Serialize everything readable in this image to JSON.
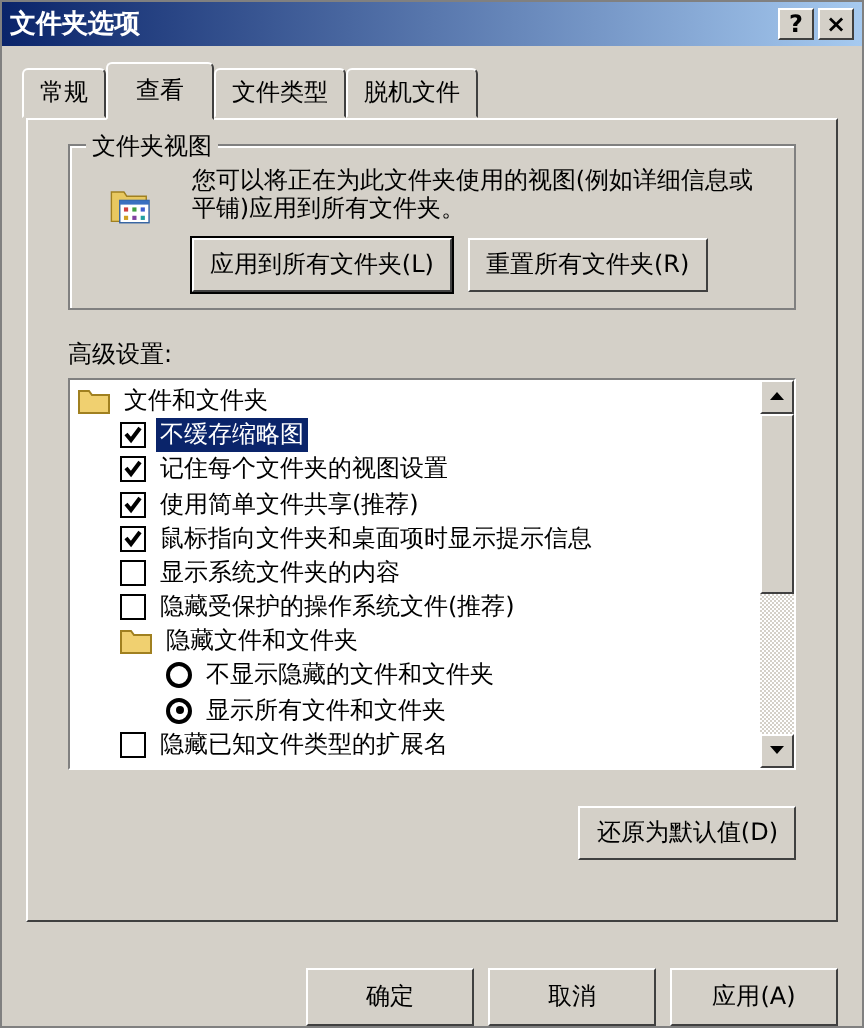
{
  "window": {
    "title": "文件夹选项",
    "help_button": "?",
    "close_button": "×"
  },
  "tabs": [
    {
      "label": "常规",
      "selected": false
    },
    {
      "label": "查看",
      "selected": true
    },
    {
      "label": "文件类型",
      "selected": false
    },
    {
      "label": "脱机文件",
      "selected": false
    }
  ],
  "folder_views": {
    "title": "文件夹视图",
    "description": "您可以将正在为此文件夹使用的视图(例如详细信息或平铺)应用到所有文件夹。",
    "buttons": [
      "应用到所有文件夹(L)",
      "重置所有文件夹(R)"
    ]
  },
  "advanced": {
    "label": "高级设置:",
    "items": [
      {
        "kind": "folder",
        "label": "文件和文件夹",
        "selected": false,
        "children": [
          {
            "kind": "checkbox",
            "label": "不缓存缩略图",
            "checked": true,
            "selected": true
          },
          {
            "kind": "checkbox",
            "label": "记住每个文件夹的视图设置",
            "checked": true,
            "selected": false
          },
          {
            "kind": "checkbox",
            "label": "使用简单文件共享(推荐)",
            "checked": true,
            "selected": false
          },
          {
            "kind": "checkbox",
            "label": "鼠标指向文件夹和桌面项时显示提示信息",
            "checked": true,
            "selected": false
          },
          {
            "kind": "checkbox",
            "label": "显示系统文件夹的内容",
            "checked": false,
            "selected": false
          },
          {
            "kind": "checkbox",
            "label": "隐藏受保护的操作系统文件(推荐)",
            "checked": false,
            "selected": false
          },
          {
            "kind": "folder",
            "label": "隐藏文件和文件夹",
            "selected": false,
            "children": [
              {
                "kind": "radio",
                "label": "不显示隐藏的文件和文件夹",
                "checked": false,
                "selected": false
              },
              {
                "kind": "radio",
                "label": "显示所有文件和文件夹",
                "checked": true,
                "selected": false
              }
            ]
          },
          {
            "kind": "checkbox",
            "label": "隐藏已知文件类型的扩展名",
            "checked": false,
            "selected": false
          }
        ]
      }
    ],
    "restore_button": "还原为默认值(D)"
  },
  "buttons": [
    "确定",
    "取消",
    "应用(A)"
  ]
}
